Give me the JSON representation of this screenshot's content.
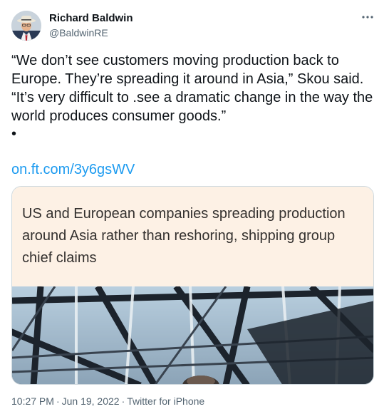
{
  "author": {
    "name": "Richard Baldwin",
    "handle": "@BaldwinRE"
  },
  "icons": {
    "more": "more-horizontal-icon",
    "avatar": "profile-photo"
  },
  "tweet": {
    "text": "“We don’t see customers moving production back to Europe. They’re spreading it around in Asia,” Skou said. “It’s very difficult to .see a dramatic change in the way the world produces consumer goods.”",
    "bullet": "•",
    "link": "on.ft.com/3y6gsWV"
  },
  "card": {
    "title": "US and European companies spreading production around Asia rather than reshoring, shipping group chief claims"
  },
  "meta": {
    "time": "10:27 PM",
    "separator": "·",
    "date": "Jun 19, 2022",
    "source": "Twitter for iPhone"
  },
  "colors": {
    "link": "#1d9bf0",
    "secondary_text": "#536471",
    "card_background": "#fdf1e5"
  }
}
